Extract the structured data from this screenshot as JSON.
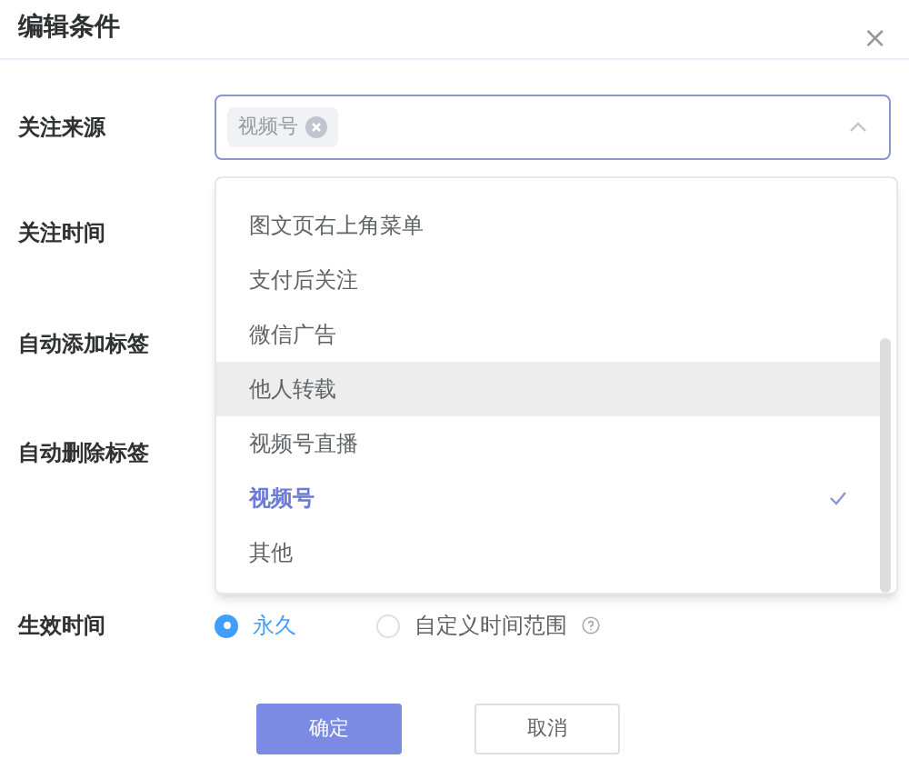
{
  "dialog": {
    "title": "编辑条件",
    "close_icon": "×"
  },
  "form": {
    "fields": [
      {
        "label": "关注来源"
      },
      {
        "label": "关注时间"
      },
      {
        "label": "自动添加标签"
      },
      {
        "label": "自动删除标签"
      },
      {
        "label": "生效时间"
      }
    ],
    "source_select": {
      "tags": [
        "视频号"
      ],
      "expanded": true
    },
    "options": [
      {
        "label": "图文页右上角菜单",
        "selected": false,
        "hovered": false
      },
      {
        "label": "支付后关注",
        "selected": false,
        "hovered": false
      },
      {
        "label": "微信广告",
        "selected": false,
        "hovered": false
      },
      {
        "label": "他人转载",
        "selected": false,
        "hovered": true
      },
      {
        "label": "视频号直播",
        "selected": false,
        "hovered": false
      },
      {
        "label": "视频号",
        "selected": true,
        "hovered": false
      },
      {
        "label": "其他",
        "selected": false,
        "hovered": false
      }
    ],
    "effective_time": [
      {
        "label": "永久",
        "selected": true,
        "help": false
      },
      {
        "label": "自定义时间范围",
        "selected": false,
        "help": true
      }
    ]
  },
  "buttons": [
    {
      "label": "确定",
      "kind": "primary"
    },
    {
      "label": "取消",
      "kind": "default"
    }
  ]
}
